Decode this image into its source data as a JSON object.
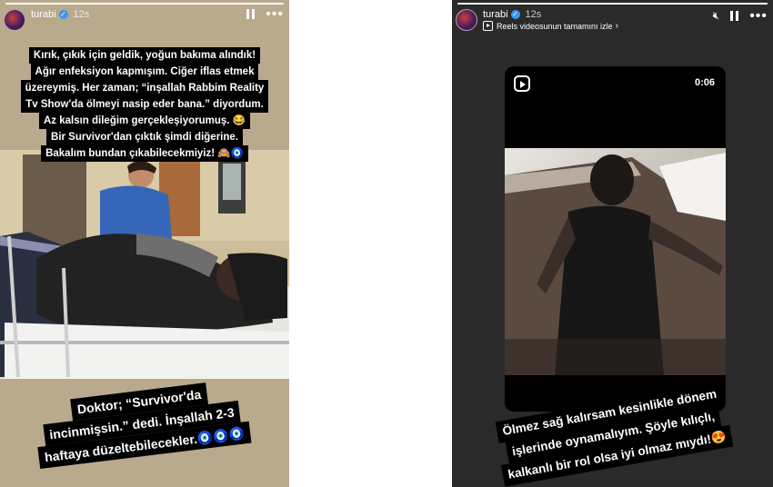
{
  "left_story": {
    "username": "turabi",
    "time": "12s",
    "progress": 1.0,
    "caption_top": [
      "Kırık, çıkık için geldik, yoğun bakıma alındık!",
      "Ağır enfeksiyon kapmışım. Ciğer iflas etmek",
      "üzereymiş. Her zaman; “inşallah Rabbim Reality",
      "Tv Show'da ölmeyi nasip eder bana.” diyordum.",
      "Az kalsın dileğim gerçekleşiyorumuş. 😂",
      "Bir Survivor'dan çıktık şimdi diğerine.",
      "Bakalım bundan çıkabilecekmiyiz! 🙈🧿"
    ],
    "caption_bottom": [
      "Doktor; “Survivor'da",
      "incinmişsin.” dedi. İnşallah 2-3",
      "haftaya düzeltebilecekler.🧿🧿🧿"
    ]
  },
  "right_story": {
    "username": "turabi",
    "time": "12s",
    "progress": 1.0,
    "reels_link": "Reels videosunun tamamını izle",
    "reel_duration": "0:06",
    "caption": [
      "Ölmez sağ kalırsam kesinlikle dönem",
      "işlerinde oynamalıyım. Şöyle kılıçlı,",
      "kalkanlı bir rol olsa iyi olmaz mıydı!😍"
    ]
  },
  "icons": {
    "verified": "verified-badge-icon",
    "pause": "pause-icon",
    "more": "more-options-icon",
    "mute": "mute-icon",
    "reel": "reels-icon"
  },
  "colors": {
    "verified": "#3897f0",
    "caption_bg": "#000000",
    "right_bg": "#2a2a2a"
  }
}
